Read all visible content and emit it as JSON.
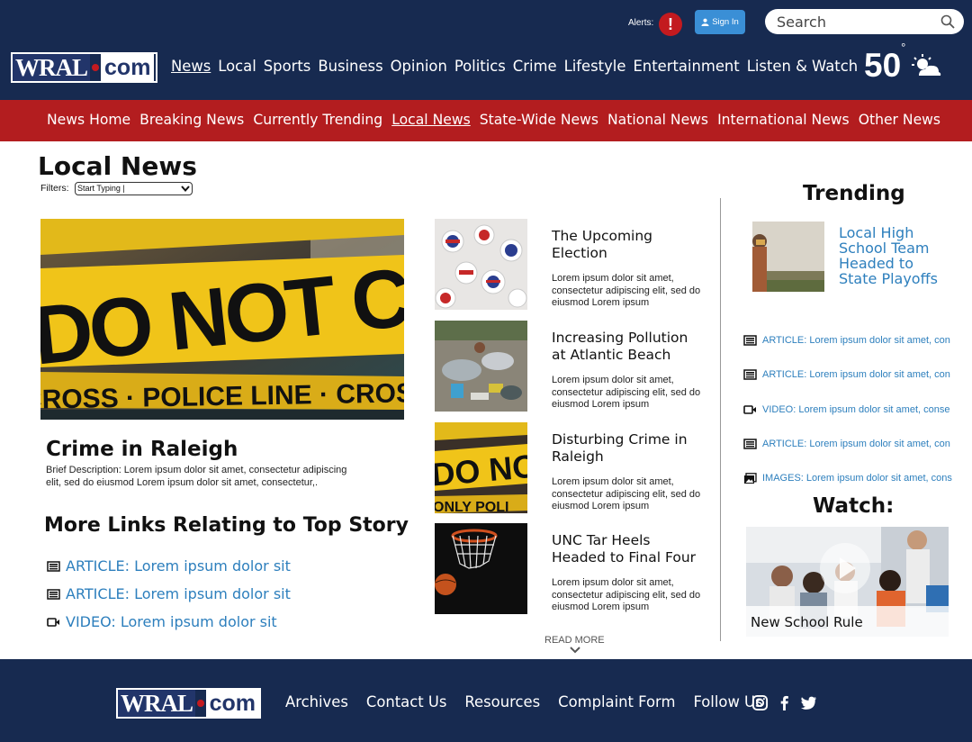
{
  "header": {
    "alerts_label": "Alerts:",
    "alert_badge": "!",
    "signin_label": "Sign In",
    "search_placeholder": "Search",
    "logo": {
      "left": "WRAL",
      "right": "com"
    },
    "nav": [
      "News",
      "Local",
      "Sports",
      "Business",
      "Opinion",
      "Politics",
      "Crime",
      "Lifestyle",
      "Entertainment",
      "Listen & Watch"
    ],
    "nav_active": "News",
    "temperature": "50",
    "temperature_unit": "°",
    "weather_icon": "partly-cloudy-icon"
  },
  "subnav": {
    "items": [
      "News Home",
      "Breaking News",
      "Currently Trending",
      "Local News",
      "State-Wide News",
      "National News",
      "International News",
      "Other News"
    ],
    "active": "Local News"
  },
  "main": {
    "title": "Local News",
    "filters_label": "Filters:",
    "filter_value": "Start Typing |",
    "hero": {
      "title": "Crime in Raleigh",
      "description": "Brief Description: Lorem ipsum dolor sit amet, consectetur adipiscing elit, sed do eiusmod Lorem ipsum dolor sit amet, consectetur,."
    },
    "more_links_title": "More Links Relating to Top Story",
    "more_links": [
      {
        "type": "article",
        "icon": "newspaper-icon",
        "label": "ARTICLE: Lorem ipsum dolor sit"
      },
      {
        "type": "article",
        "icon": "newspaper-icon",
        "label": "ARTICLE: Lorem ipsum dolor sit"
      },
      {
        "type": "video",
        "icon": "video-camera-icon",
        "label": "VIDEO: Lorem ipsum dolor sit"
      }
    ],
    "stories": [
      {
        "title": "The Upcoming Election",
        "description": "Lorem ipsum dolor sit amet, consectetur adipiscing elit, sed do eiusmod Lorem ipsum"
      },
      {
        "title": "Increasing Pollution at Atlantic Beach",
        "description": "Lorem ipsum dolor sit amet, consectetur adipiscing elit, sed do eiusmod Lorem ipsum"
      },
      {
        "title": "Disturbing Crime in Raleigh",
        "description": "Lorem ipsum dolor sit amet, consectetur adipiscing elit, sed do eiusmod Lorem ipsum"
      },
      {
        "title": "UNC Tar Heels Headed to Final Four",
        "description": "Lorem ipsum dolor sit amet, consectetur adipiscing elit, sed do eiusmod Lorem ipsum"
      }
    ],
    "read_more": "READ MORE"
  },
  "sidebar": {
    "trending_title": "Trending",
    "trending_headline": "Local High School Team Headed to State Playoffs",
    "trending_links": [
      {
        "icon": "newspaper-icon",
        "label": "ARTICLE: Lorem ipsum dolor sit amet, con"
      },
      {
        "icon": "newspaper-icon",
        "label": "ARTICLE: Lorem ipsum dolor sit amet, con"
      },
      {
        "icon": "video-camera-icon",
        "label": "VIDEO: Lorem ipsum dolor sit amet, conse"
      },
      {
        "icon": "newspaper-icon",
        "label": "ARTICLE: Lorem ipsum dolor sit amet, con"
      },
      {
        "icon": "images-icon",
        "label": "IMAGES: Lorem ipsum dolor sit amet, cons"
      }
    ],
    "watch_title": "Watch:",
    "watch_caption": "New School Rule"
  },
  "footer": {
    "logo": {
      "left": "WRAL",
      "right": "com"
    },
    "links": [
      "Archives",
      "Contact Us",
      "Resources",
      "Complaint Form",
      "Follow Us"
    ],
    "social": [
      "instagram-icon",
      "facebook-icon",
      "twitter-icon"
    ]
  },
  "colors": {
    "navy": "#172a50",
    "red": "#b31d1f",
    "link_blue": "#2d7fbd",
    "signin_blue": "#3a8fd6",
    "alert_red": "#c31a1f"
  }
}
